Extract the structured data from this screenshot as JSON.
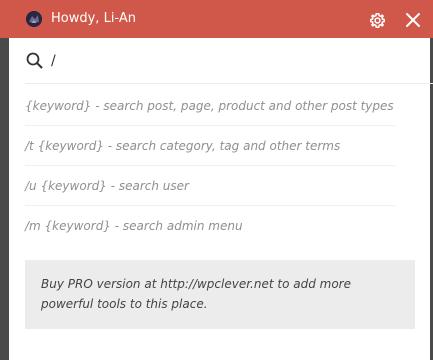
{
  "header": {
    "greeting": "Howdy, Li-An",
    "bg_color": "#d0584a",
    "avatar_icon": "avatar-icon",
    "settings_icon": "gear-icon",
    "close_icon": "close-icon"
  },
  "search": {
    "value": "/",
    "icon": "search-icon"
  },
  "hints": [
    {
      "text": "{keyword} - search post, page, product and other post types"
    },
    {
      "text": "/t {keyword} - search category, tag and other terms"
    },
    {
      "text": "/u {keyword} - search user"
    },
    {
      "text": "/m {keyword} - search admin menu"
    }
  ],
  "pro": {
    "message": "Buy PRO version at http://wpclever.net to add more powerful tools to this place."
  }
}
